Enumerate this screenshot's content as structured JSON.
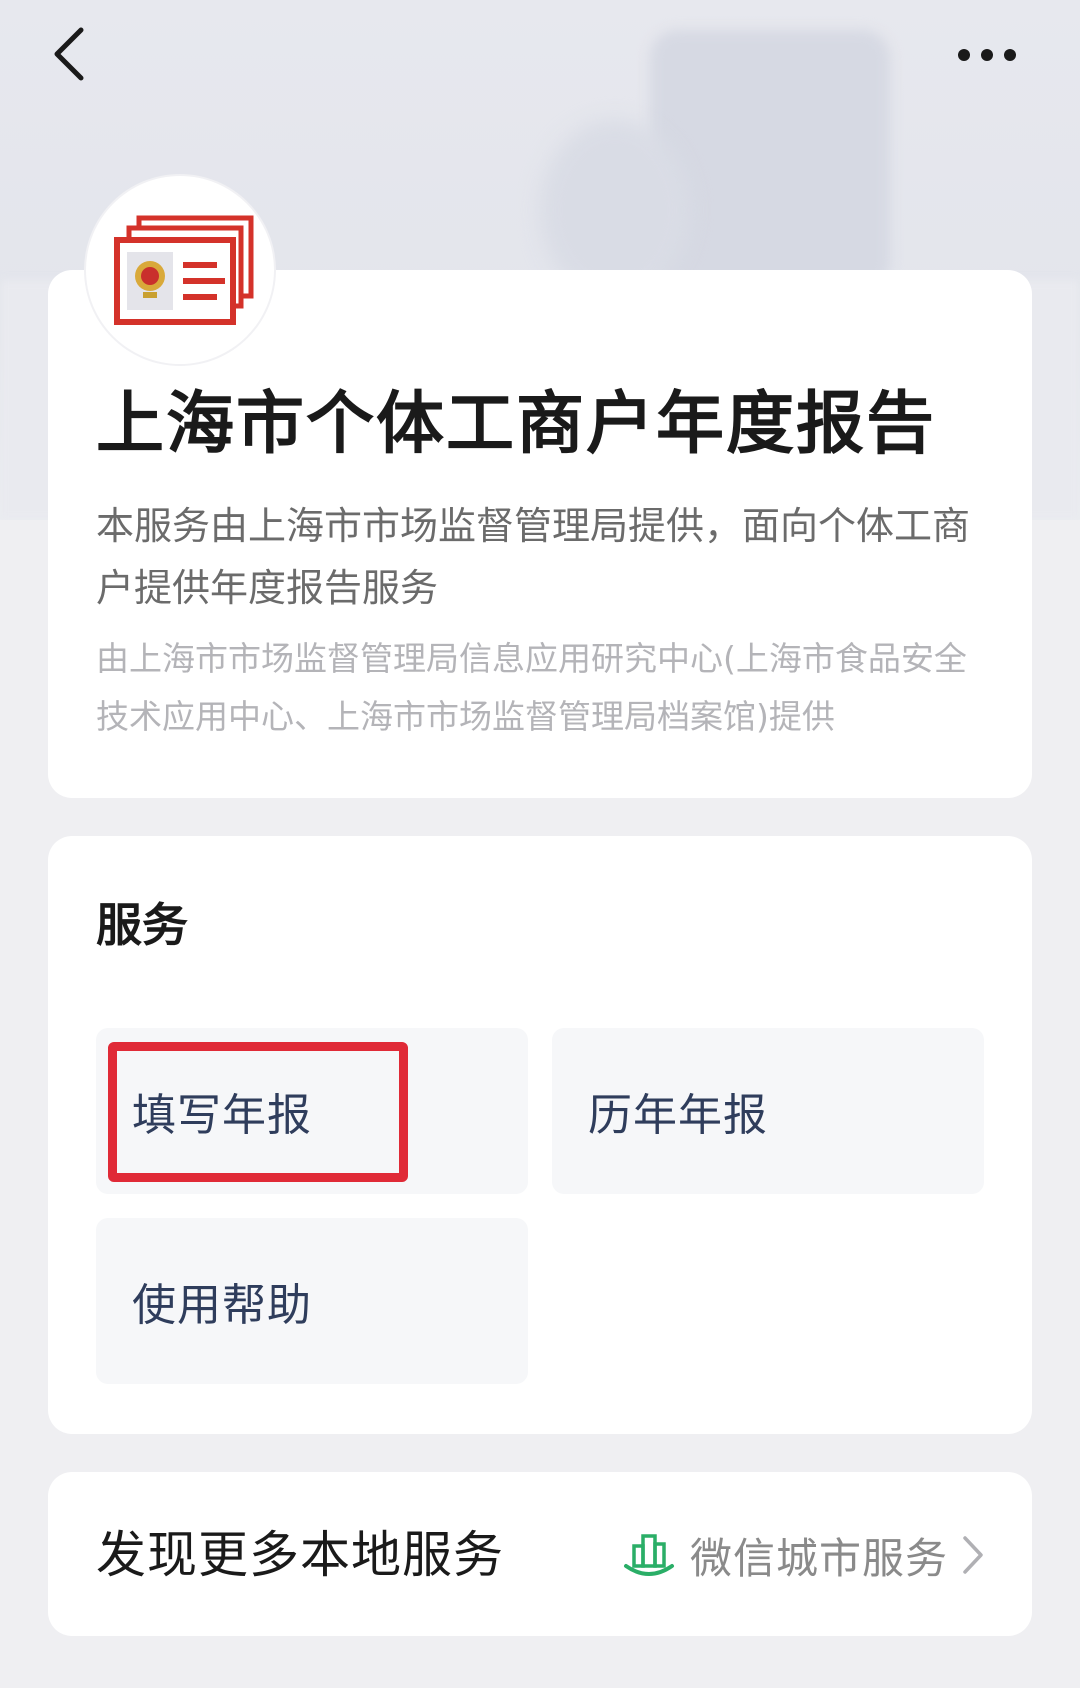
{
  "nav": {
    "back_icon": "chevron-left-icon",
    "more_icon": "more-horizontal-icon"
  },
  "service": {
    "logo_icon": "business-license-icon",
    "title": "上海市个体工商户年度报告",
    "description": "本服务由上海市市场监督管理局提供，面向个体工商户提供年度报告服务",
    "provider": "由上海市市场监督管理局信息应用研究中心(上海市食品安全技术应用中心、上海市市场监督管理局档案馆)提供"
  },
  "services_section": {
    "title": "服务",
    "items": [
      {
        "label": "填写年报",
        "highlighted": true
      },
      {
        "label": "历年年报",
        "highlighted": false
      },
      {
        "label": "使用帮助",
        "highlighted": false
      }
    ],
    "highlight_color": "#e02a37"
  },
  "discover": {
    "label": "发现更多本地服务",
    "city_service_label": "微信城市服务",
    "city_icon": "city-building-icon",
    "arrow_icon": "chevron-right-icon",
    "accent_color": "#2aae67"
  }
}
